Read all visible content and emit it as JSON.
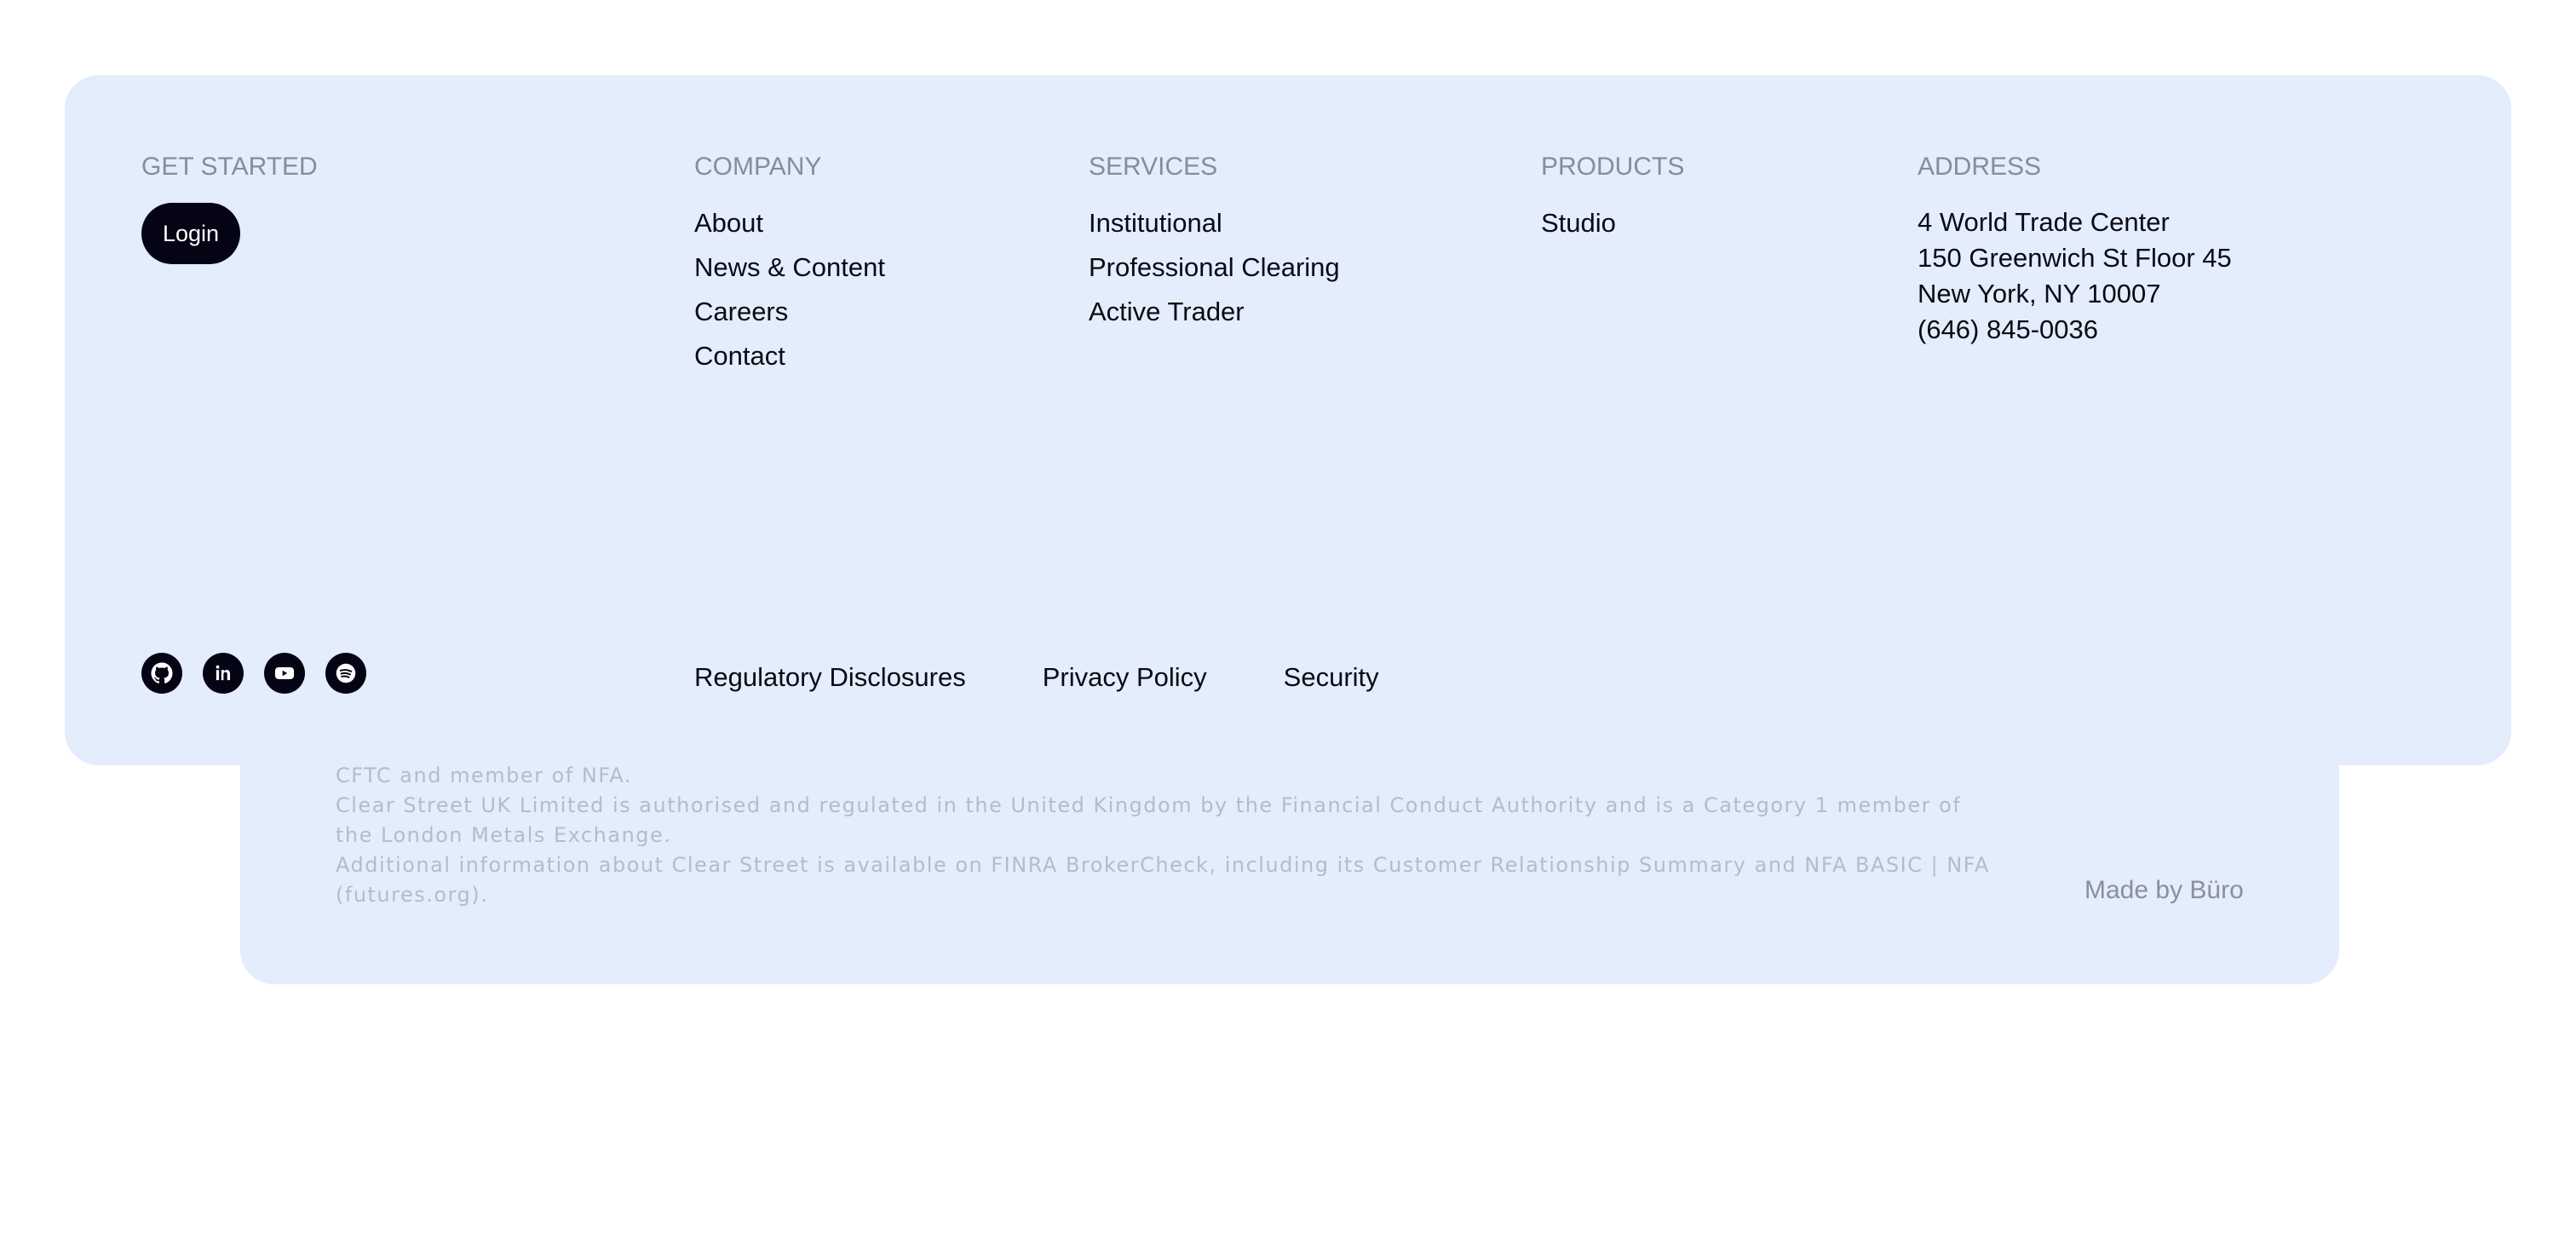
{
  "footer": {
    "get_started": {
      "heading": "GET STARTED",
      "login_label": "Login"
    },
    "company": {
      "heading": "COMPANY",
      "links": [
        "About",
        "News & Content",
        "Careers",
        "Contact"
      ]
    },
    "services": {
      "heading": "SERVICES",
      "links": [
        "Institutional",
        "Professional Clearing",
        "Active Trader"
      ]
    },
    "products": {
      "heading": "PRODUCTS",
      "links": [
        "Studio"
      ]
    },
    "address": {
      "heading": "ADDRESS",
      "lines": [
        "4 World Trade Center",
        "150 Greenwich St Floor 45",
        "New York, NY 10007",
        "(646) 845-0036"
      ]
    },
    "socials": [
      "github-icon",
      "linkedin-icon",
      "youtube-icon",
      "spotify-icon"
    ],
    "bottom_links": [
      "Regulatory Disclosures",
      "Privacy Policy",
      "Security"
    ]
  },
  "legal": {
    "paragraphs": [
      "CFTC and member of NFA.",
      "Clear Street UK Limited is authorised and regulated in the United Kingdom by the Financial Conduct Authority and is a Category 1 member of the London Metals Exchange.",
      "Additional information about Clear Street is available on FINRA BrokerCheck, including its Customer Relationship Summary and NFA BASIC | NFA (futures.org)."
    ],
    "made_by": "Made by Büro"
  },
  "colors": {
    "card_background": "#e3edfc",
    "heading_gray": "#858d9c",
    "text_dark": "#0a0a14",
    "button_dark": "#040414",
    "legal_gray": "#b4bccc"
  }
}
